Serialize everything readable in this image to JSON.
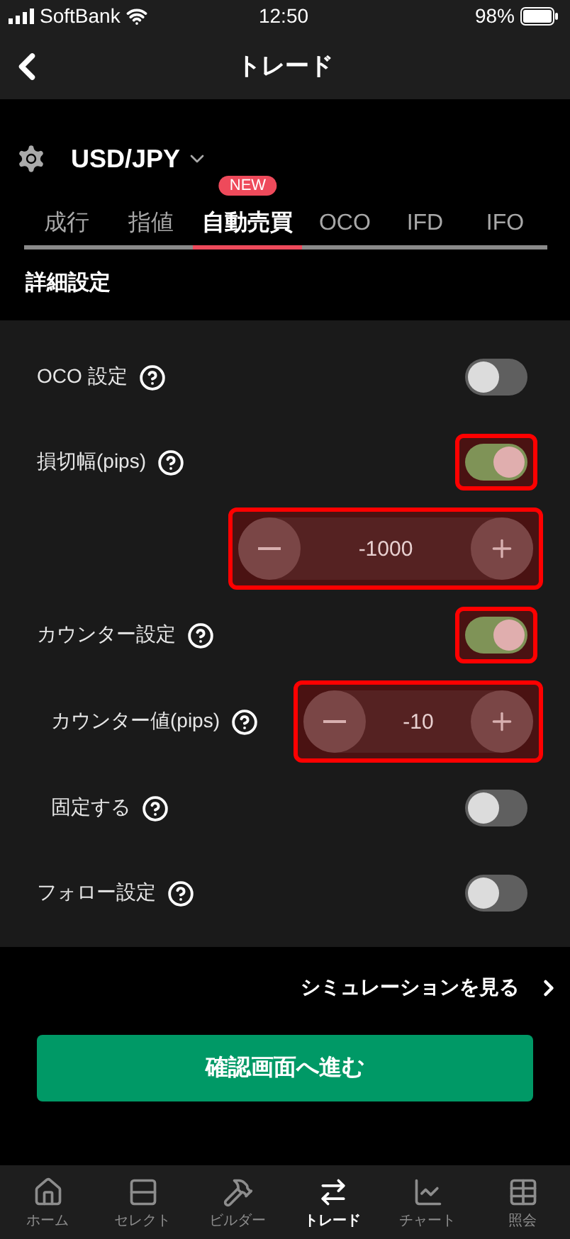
{
  "status_bar": {
    "carrier": "SoftBank",
    "time": "12:50",
    "battery": "98%"
  },
  "nav": {
    "title": "トレード"
  },
  "currency": {
    "pair": "USD/JPY"
  },
  "tabs": [
    {
      "label": "成行",
      "selected": false
    },
    {
      "label": "指値",
      "selected": false
    },
    {
      "label": "自動売買",
      "selected": true,
      "badge": "NEW"
    },
    {
      "label": "OCO",
      "selected": false
    },
    {
      "label": "IFD",
      "selected": false
    },
    {
      "label": "IFO",
      "selected": false
    }
  ],
  "section_title": "詳細設定",
  "rows": [
    {
      "kind": "toggle",
      "label": "OCO 設定",
      "on": false,
      "highlighted": false
    },
    {
      "kind": "toggle",
      "label": "損切幅(pips)",
      "on": true,
      "highlighted": true,
      "children": [
        {
          "kind": "stepper",
          "value": "-1000",
          "highlighted": true
        }
      ]
    },
    {
      "kind": "toggle",
      "label": "カウンター設定",
      "on": true,
      "highlighted": true,
      "children": [
        {
          "kind": "stepper",
          "label": "カウンター値(pips)",
          "value": "-10",
          "highlighted": true
        },
        {
          "kind": "toggle",
          "label": "固定する",
          "on": false,
          "highlighted": false
        }
      ]
    },
    {
      "kind": "toggle",
      "label": "フォロー設定",
      "on": false,
      "highlighted": false
    }
  ],
  "simulation_link": "シミュレーションを見る",
  "confirm_button": "確認画面へ進む",
  "tab_bar": [
    {
      "label": "ホーム",
      "selected": false
    },
    {
      "label": "セレクト",
      "selected": false
    },
    {
      "label": "ビルダー",
      "selected": false
    },
    {
      "label": "トレード",
      "selected": true
    },
    {
      "label": "チャート",
      "selected": false
    },
    {
      "label": "照会",
      "selected": false
    }
  ]
}
